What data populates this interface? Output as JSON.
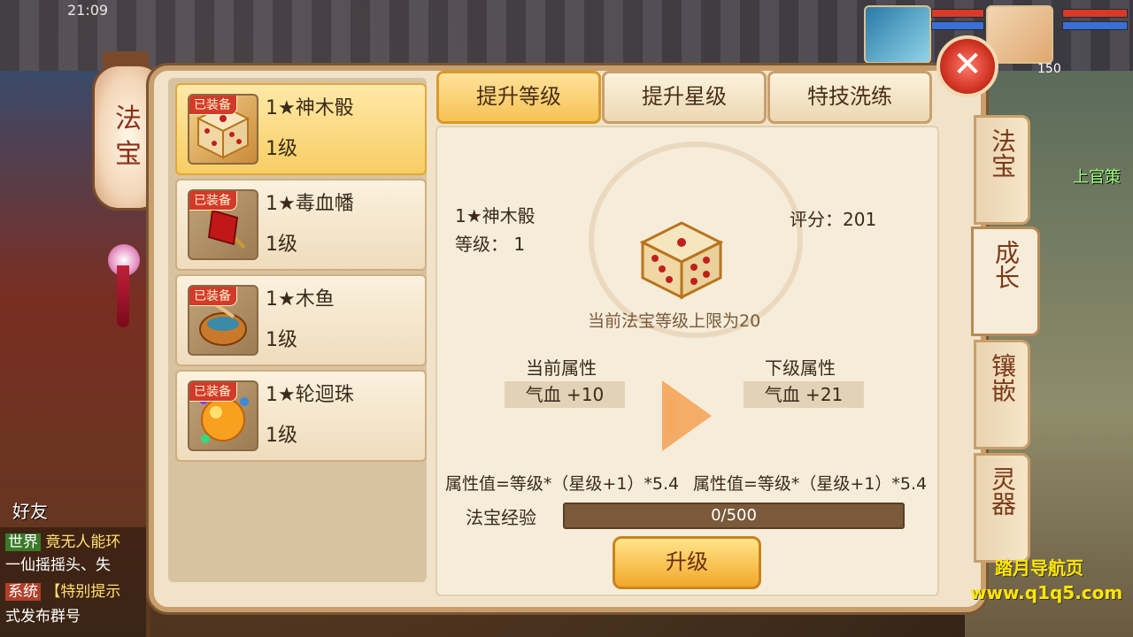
{
  "status_bar": {
    "time": "21:09"
  },
  "hud": {
    "companion_level": "150",
    "npc_name": "上官策"
  },
  "lantern": {
    "title_line1": "法",
    "title_line2": "宝"
  },
  "items": [
    {
      "badge": "已装备",
      "name": "1★神木骰",
      "level": "1级",
      "selected": true
    },
    {
      "badge": "已装备",
      "name": "1★毒血幡",
      "level": "1级",
      "selected": false
    },
    {
      "badge": "已装备",
      "name": "1★木鱼",
      "level": "1级",
      "selected": false
    },
    {
      "badge": "已装备",
      "name": "1★轮迴珠",
      "level": "1级",
      "selected": false
    }
  ],
  "top_tabs": [
    {
      "label": "提升等级",
      "active": true
    },
    {
      "label": "提升星级",
      "active": false
    },
    {
      "label": "特技洗练",
      "active": false
    }
  ],
  "side_tabs": [
    {
      "label": "法宝",
      "active": false
    },
    {
      "label": "成长",
      "active": true
    },
    {
      "label": "镶嵌",
      "active": false
    },
    {
      "label": "灵器",
      "active": false
    }
  ],
  "detail": {
    "name": "1★神木骰",
    "level_label": "等级： 1",
    "score_label": "评分：201",
    "limit_text": "当前法宝等级上限为20",
    "current_attr_title": "当前属性",
    "next_attr_title": "下级属性",
    "current_attr_value": "气血 +10",
    "next_attr_value": "气血 +21",
    "formula_left": "属性值=等级*（星级+1）*5.4",
    "formula_right": "属性值=等级*（星级+1）*5.4",
    "exp_label": "法宝经验",
    "exp_text": "0/500",
    "exp_fraction": 0,
    "upgrade_label": "升级"
  },
  "chat": {
    "friend_label": "好友",
    "lines": [
      {
        "tag": "世界",
        "text": "竟无人能环"
      },
      {
        "tag": "",
        "text": "一仙摇摇头、失"
      },
      {
        "tag": "系统",
        "text": "【特别提示"
      },
      {
        "tag": "",
        "text": "式发布群号"
      }
    ]
  },
  "watermark": {
    "line1": "踏月导航页",
    "line2": "www.q1q5.com"
  },
  "colors": {
    "accent": "#f6c255",
    "panel": "#f1e3c9",
    "badge": "#d23a2a"
  }
}
